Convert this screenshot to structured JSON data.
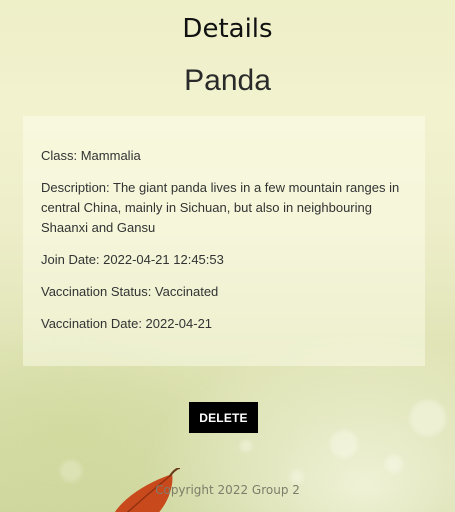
{
  "header": {
    "title": "Details",
    "animal_name": "Panda"
  },
  "details": {
    "class": "Class: Mammalia",
    "description": "Description: The giant panda lives in a few mountain ranges in central China, mainly in Sichuan, but also in neighbouring Shaanxi and Gansu",
    "join_date": "Join Date: 2022-04-21 12:45:53",
    "vaccination_status": "Vaccination Status: Vaccinated",
    "vaccination_date": "Vaccination Date: 2022-04-21"
  },
  "actions": {
    "delete_label": "DELETE"
  },
  "footer": {
    "copyright": "Copyright 2022 Group 2"
  },
  "colors": {
    "button_bg": "#000000",
    "button_text": "#ffffff",
    "leaf": "#c84a1c"
  },
  "icons": {
    "leaf": "leaf-icon"
  }
}
